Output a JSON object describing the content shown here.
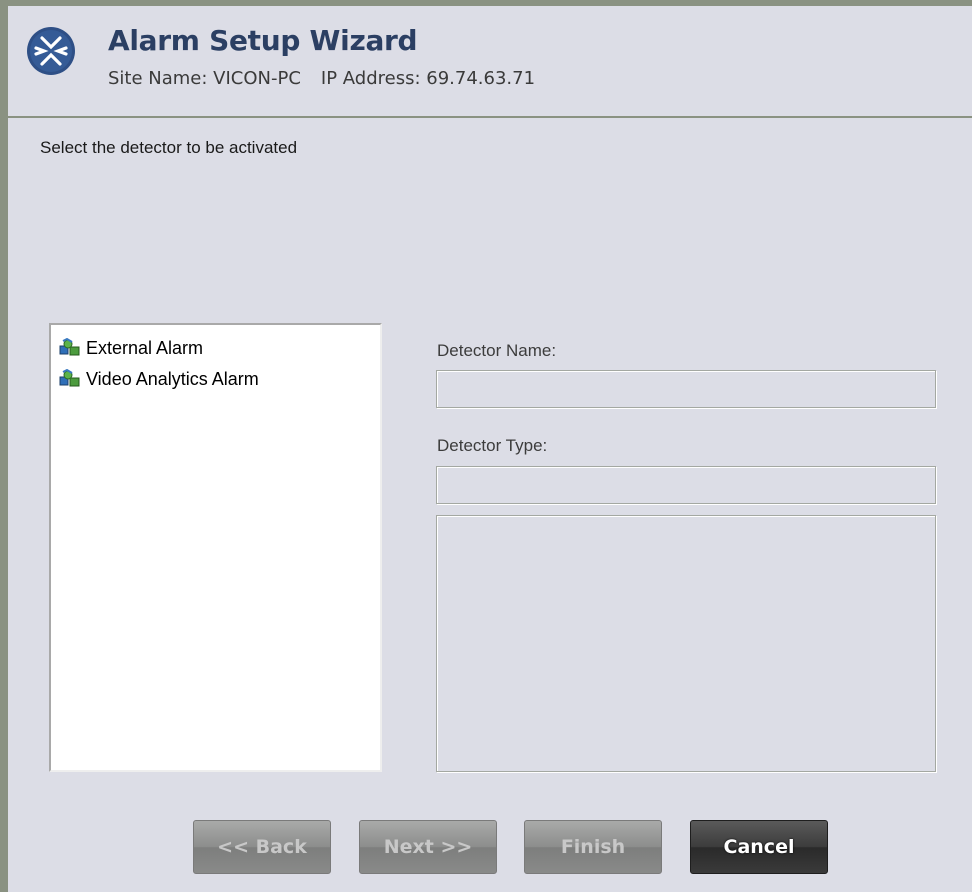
{
  "header": {
    "title": "Alarm Setup Wizard",
    "site_label": "Site Name: VICON-PC",
    "ip_label": "IP Address: 69.74.63.71",
    "logo_icon": "vicon-logo-icon"
  },
  "instruction": "Select the detector to be activated",
  "detectors": [
    {
      "label": "External Alarm",
      "icon": "alarm-detector-icon"
    },
    {
      "label": "Video Analytics Alarm",
      "icon": "alarm-detector-icon"
    }
  ],
  "detail": {
    "name_label": "Detector Name:",
    "name_value": "",
    "type_label": "Detector Type:",
    "type_value": "",
    "description_value": ""
  },
  "buttons": {
    "back": "<< Back",
    "next": "Next >>",
    "finish": "Finish",
    "cancel": "Cancel"
  },
  "colors": {
    "title": "#2b3f63",
    "background": "#dcdde6",
    "border": "#8a9282"
  }
}
